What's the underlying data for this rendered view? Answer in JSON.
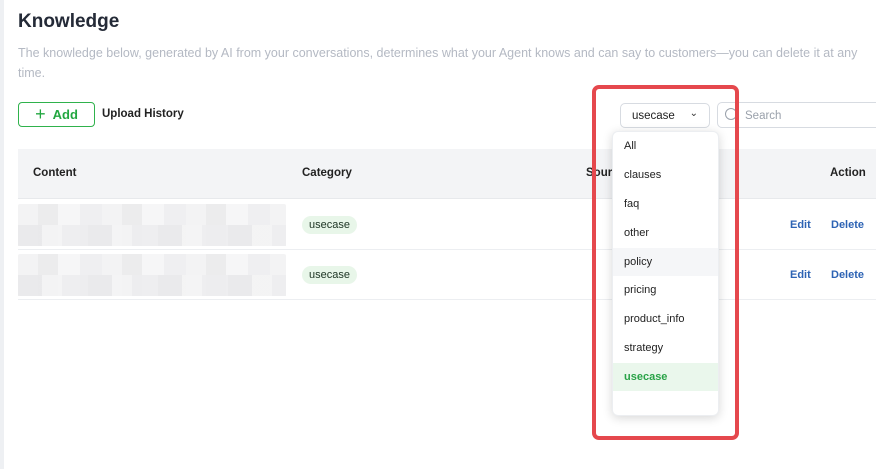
{
  "page": {
    "title": "Knowledge",
    "description": "The knowledge below, generated by AI from your conversations, determines what your Agent knows and can say to customers—you can delete it at any time."
  },
  "toolbar": {
    "add_icon": "+",
    "add_label": "Add",
    "upload_history_label": "Upload History",
    "filter_value": "usecase",
    "filter_chevron": "⌄",
    "search_placeholder": "Search"
  },
  "table": {
    "headers": {
      "content": "Content",
      "category": "Category",
      "source": "Sour",
      "action": "Action"
    },
    "rows": [
      {
        "category": "usecase",
        "edit": "Edit",
        "delete": "Delete"
      },
      {
        "category": "usecase",
        "edit": "Edit",
        "delete": "Delete"
      }
    ]
  },
  "dropdown": {
    "options": [
      "All",
      "clauses",
      "faq",
      "other",
      "policy",
      "pricing",
      "product_info",
      "strategy",
      "usecase"
    ],
    "hovered": "policy",
    "selected": "usecase"
  },
  "colors": {
    "accent_green": "#2fb24c",
    "link_blue": "#2d63b4",
    "highlight_red": "#e5484d"
  }
}
